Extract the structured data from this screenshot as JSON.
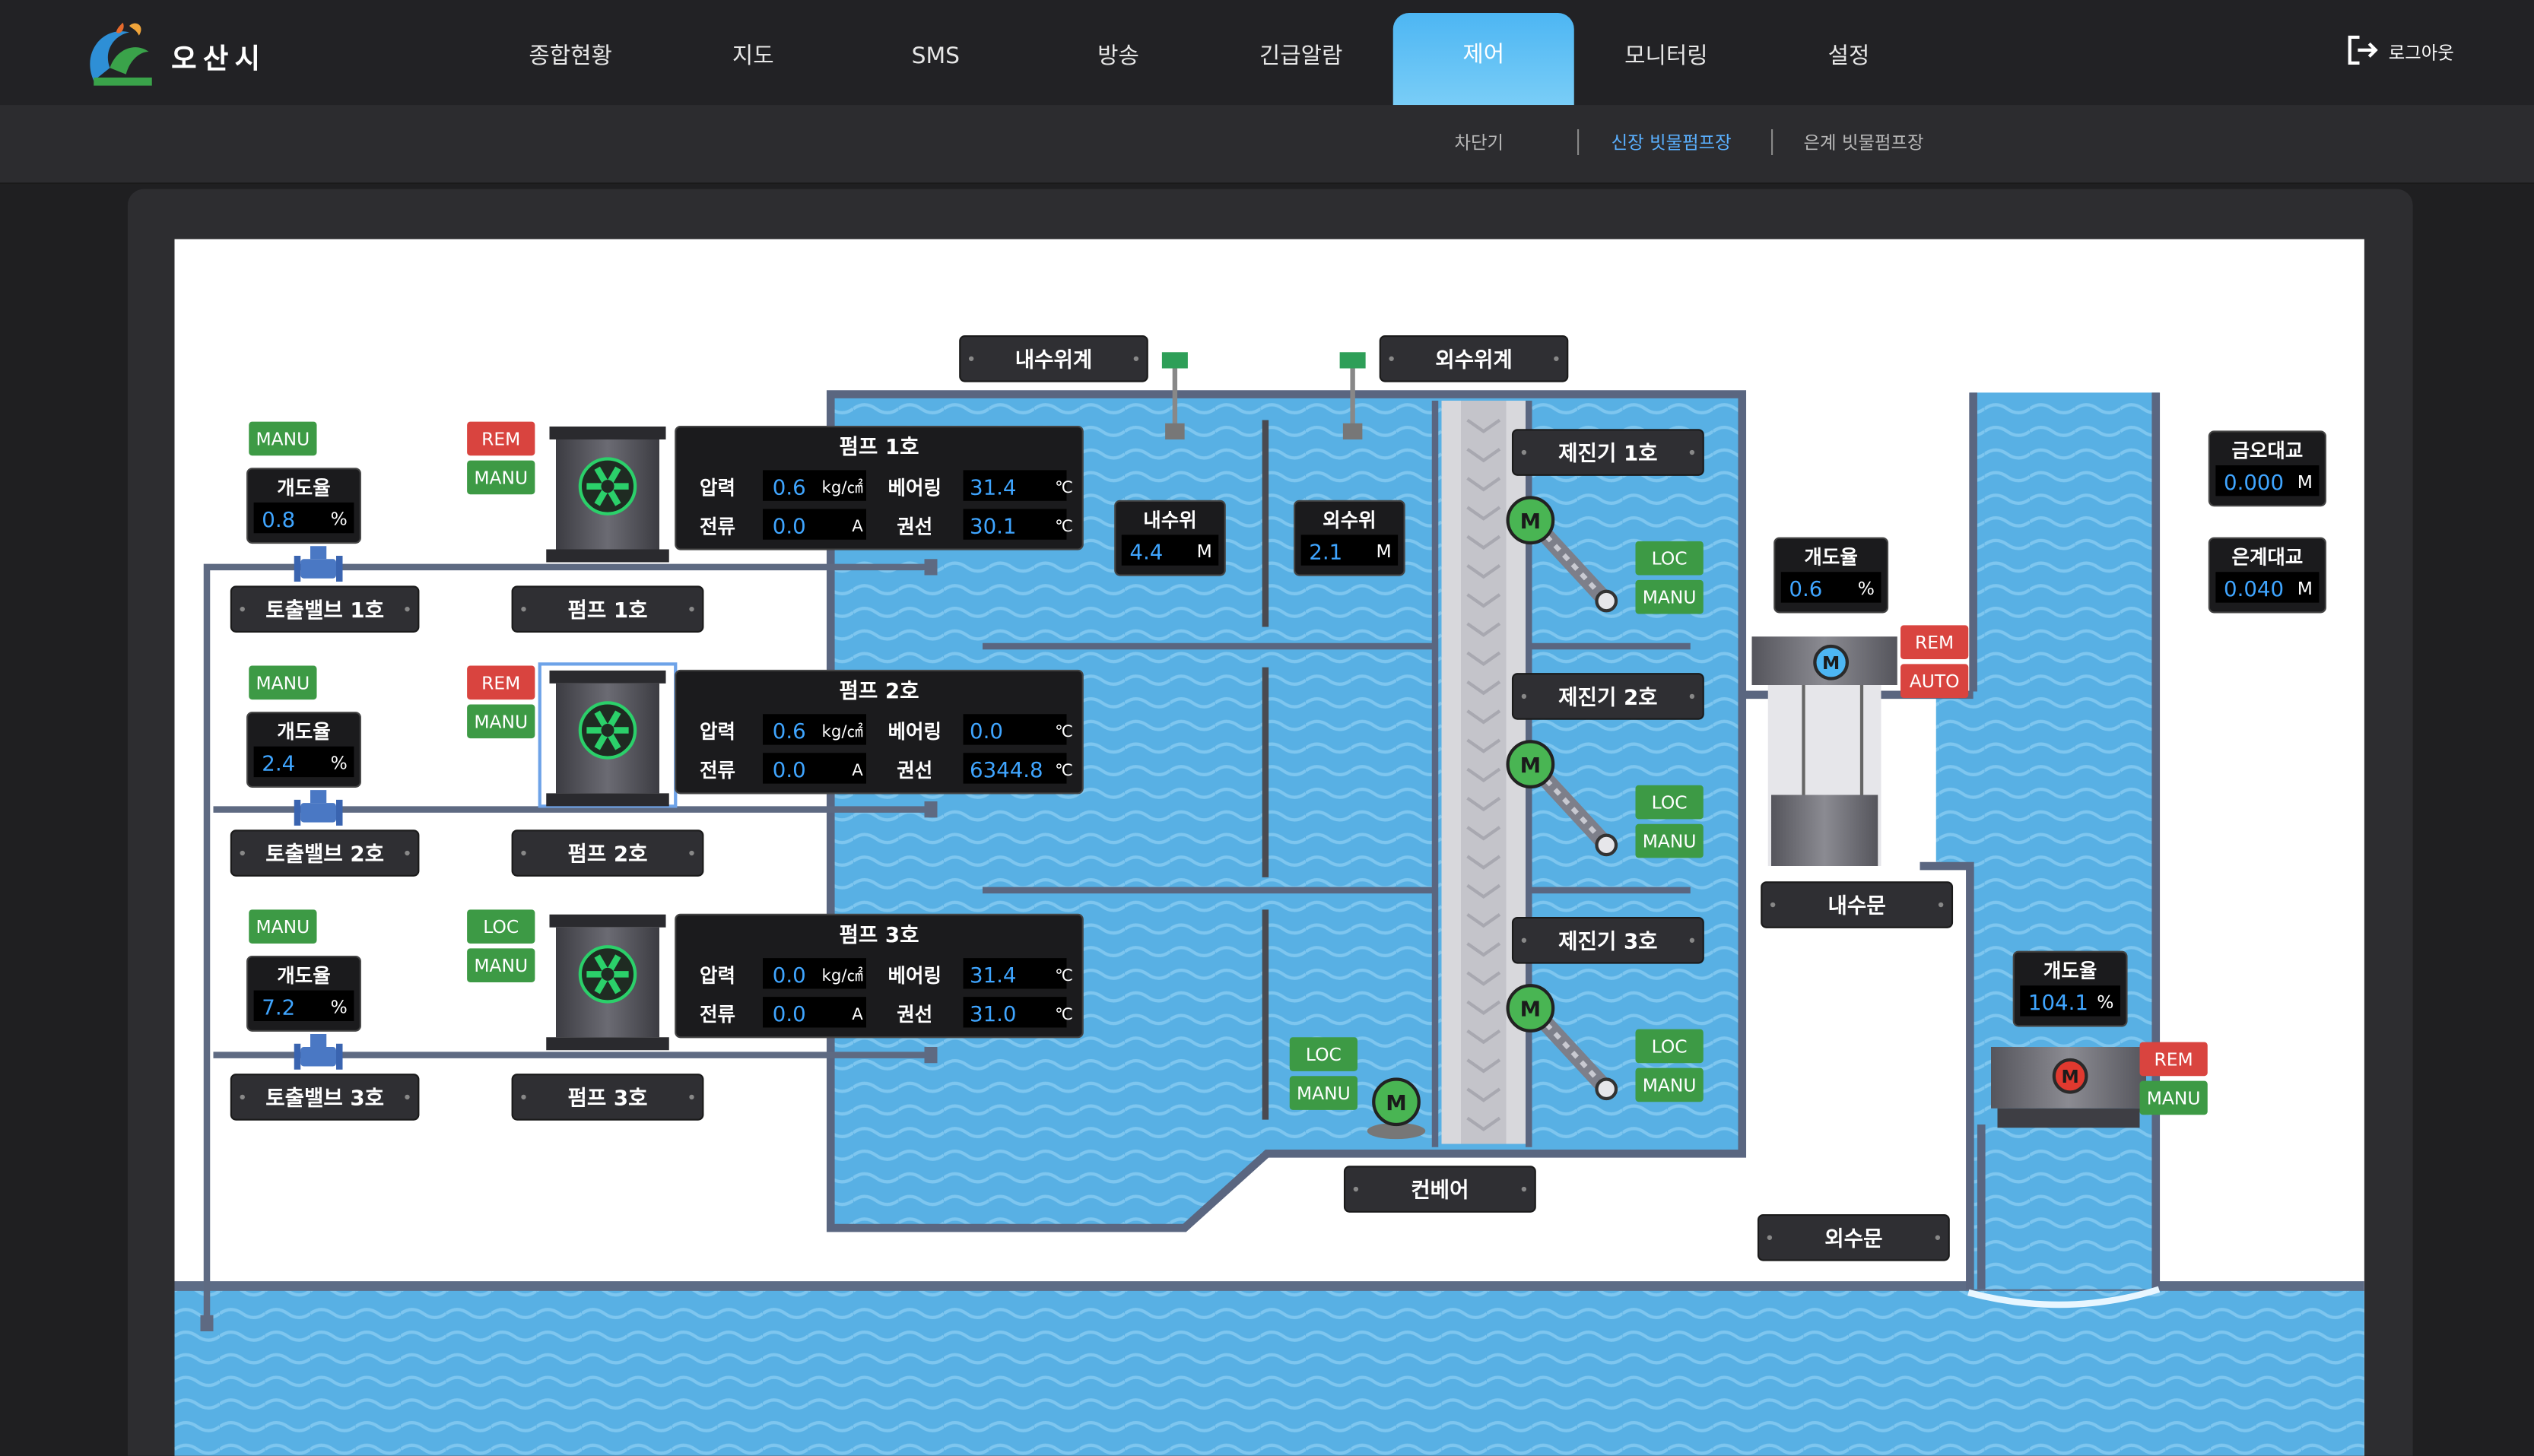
{
  "header": {
    "logo_text": "오산시",
    "nav": [
      "종합현황",
      "지도",
      "SMS",
      "방송",
      "긴급알람",
      "제어",
      "모니터링",
      "설정"
    ],
    "active_nav": "제어",
    "logout_label": "로그아웃"
  },
  "subnav": {
    "items": [
      "차단기",
      "신장 빗물펌프장",
      "은계 빗물펌프장"
    ],
    "active": "신장 빗물펌프장"
  },
  "sensors": {
    "inner_gauge_label": "내수위계",
    "outer_gauge_label": "외수위계",
    "inner_level_label": "내수위",
    "inner_level_value": "4.4",
    "inner_level_unit": "M",
    "outer_level_label": "외수위",
    "outer_level_value": "2.1",
    "outer_level_unit": "M"
  },
  "valves": [
    {
      "name": "토출밸브 1호",
      "mode": "MANU",
      "opening_label": "개도율",
      "opening": "0.8",
      "unit": "%"
    },
    {
      "name": "토출밸브 2호",
      "mode": "MANU",
      "opening_label": "개도율",
      "opening": "2.4",
      "unit": "%"
    },
    {
      "name": "토출밸브 3호",
      "mode": "MANU",
      "opening_label": "개도율",
      "opening": "7.2",
      "unit": "%"
    }
  ],
  "pumps": [
    {
      "name": "펌프 1호",
      "control": "REM",
      "mode": "MANU",
      "pressure": "0.6",
      "pressure_unit": "kg/㎠",
      "bearing": "31.4",
      "current": "0.0",
      "current_unit": "A",
      "winding": "30.1",
      "temp_unit": "℃"
    },
    {
      "name": "펌프 2호",
      "control": "REM",
      "mode": "MANU",
      "pressure": "0.6",
      "pressure_unit": "kg/㎠",
      "bearing": "0.0",
      "current": "0.0",
      "current_unit": "A",
      "winding": "6344.8",
      "temp_unit": "℃"
    },
    {
      "name": "펌프 3호",
      "control": "LOC",
      "mode": "MANU",
      "pressure": "0.0",
      "pressure_unit": "kg/㎠",
      "bearing": "31.4",
      "current": "0.0",
      "current_unit": "A",
      "winding": "31.0",
      "temp_unit": "℃"
    }
  ],
  "pump_labels": {
    "pressure": "압력",
    "bearing": "베어링",
    "current": "전류",
    "winding": "권선"
  },
  "screens": [
    {
      "name": "제진기 1호",
      "control": "LOC",
      "mode": "MANU"
    },
    {
      "name": "제진기 2호",
      "control": "LOC",
      "mode": "MANU"
    },
    {
      "name": "제진기 3호",
      "control": "LOC",
      "mode": "MANU"
    }
  ],
  "conveyor": {
    "name": "컨베어",
    "control": "LOC",
    "mode": "MANU"
  },
  "motor_letter": "M",
  "inner_gate": {
    "name": "내수문",
    "opening_label": "개도율",
    "opening": "0.6",
    "unit": "%",
    "control": "REM",
    "mode": "AUTO"
  },
  "outer_gate": {
    "name": "외수문",
    "opening_label": "개도율",
    "opening": "104.1",
    "unit": "%",
    "control": "REM",
    "mode": "MANU"
  },
  "bridges": [
    {
      "name": "금오대교",
      "value": "0.000",
      "unit": "M"
    },
    {
      "name": "은계대교",
      "value": "0.040",
      "unit": "M"
    }
  ],
  "colors": {
    "accent": "#4db6f3",
    "water": "#5bb4e6",
    "rem": "#d9443f",
    "loc": "#3d9a45",
    "value": "#3fa5ff"
  }
}
